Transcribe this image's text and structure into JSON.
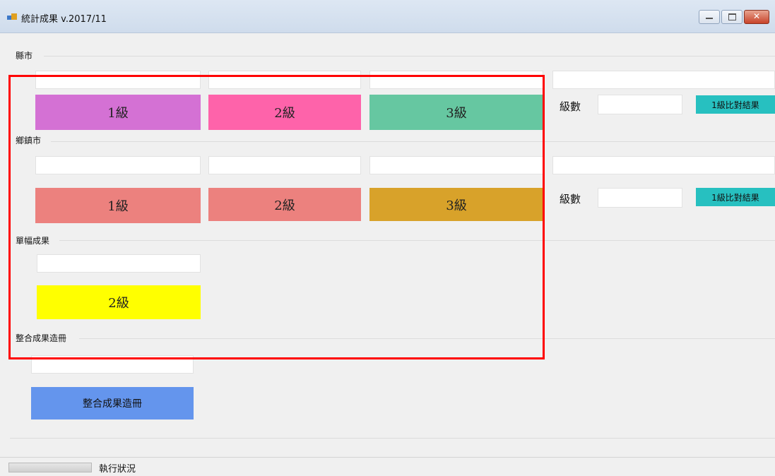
{
  "window": {
    "title": "統計成果 v.2017/11"
  },
  "colors": {
    "county_level1": "#d471d4",
    "county_level2": "#fe63aa",
    "county_level3": "#66c7a1",
    "town_level1": "#ec817e",
    "town_level2": "#ec817e",
    "town_level3": "#d8a22a",
    "sheet_level2": "#ffff00",
    "compare": "#27c0c0",
    "merge": "#6495ed",
    "highlight": "#ff0000"
  },
  "county": {
    "label": "縣市",
    "level_buttons": [
      "1級",
      "2級",
      "3級"
    ],
    "level_count_label": "級數",
    "compare_button": "1級比對結果"
  },
  "town": {
    "label": "鄉鎮市",
    "level_buttons": [
      "1級",
      "2級",
      "3級"
    ],
    "level_count_label": "級數",
    "compare_button": "1級比對結果"
  },
  "sheet": {
    "label": "單幅成果",
    "level_button": "2級"
  },
  "merge": {
    "label": "整合成果造冊",
    "button": "整合成果造冊"
  },
  "status": {
    "text": "執行狀況"
  }
}
